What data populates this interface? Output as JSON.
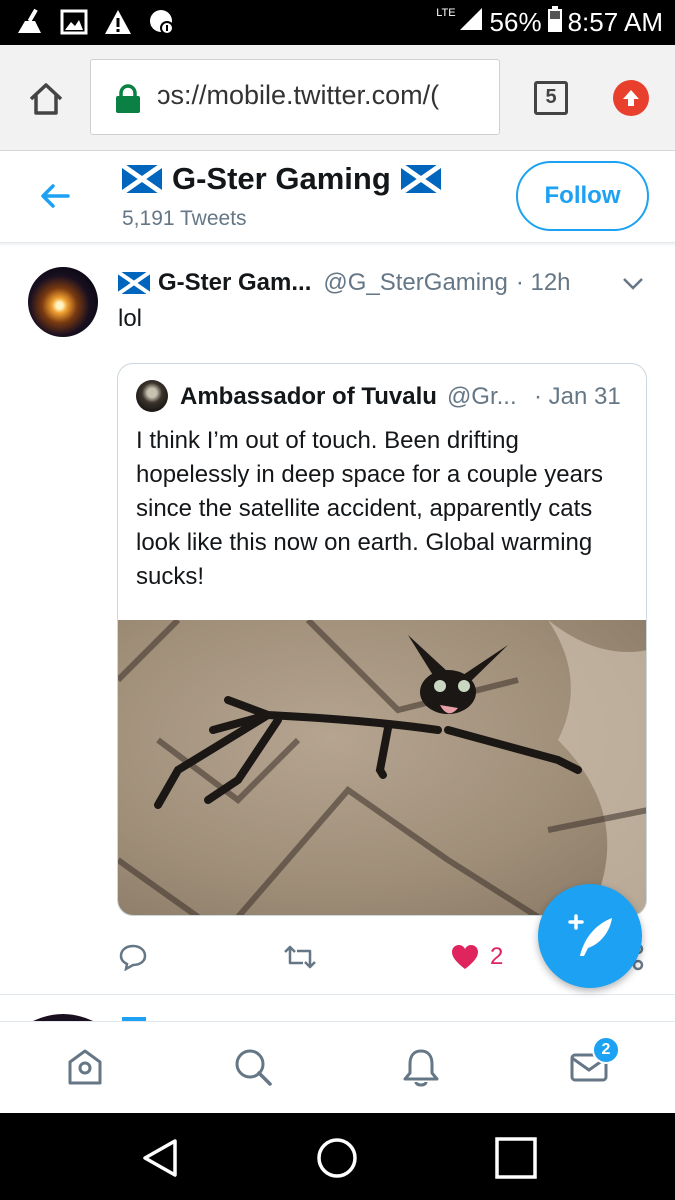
{
  "status_bar": {
    "network": "LTE",
    "battery": "56%",
    "time": "8:57 AM"
  },
  "browser": {
    "url": "ɔs://mobile.twitter.com/(",
    "tab_count": "5"
  },
  "profile_header": {
    "name": "G-Ster Gaming",
    "tweet_count": "5,191 Tweets",
    "follow_label": "Follow"
  },
  "tweet": {
    "author_name": "G-Ster Gam...",
    "handle": "@G_SterGaming",
    "time": "· 12h",
    "text": "lol",
    "quoted": {
      "author_name": "Ambassador of Tuvalu",
      "handle": "@Gr...",
      "date": "· Jan 31",
      "text": "I think I’m out of touch. Been drifting hopelessly in deep space for a couple years since the satellite accident, apparently cats look like this now on earth. Global warming sucks!"
    },
    "like_count": "2"
  },
  "bottom_nav": {
    "messages_badge": "2"
  },
  "colors": {
    "accent": "#1da1f2",
    "like": "#e0245e",
    "secondary_text": "#657786",
    "flag_blue": "#0065bd"
  }
}
